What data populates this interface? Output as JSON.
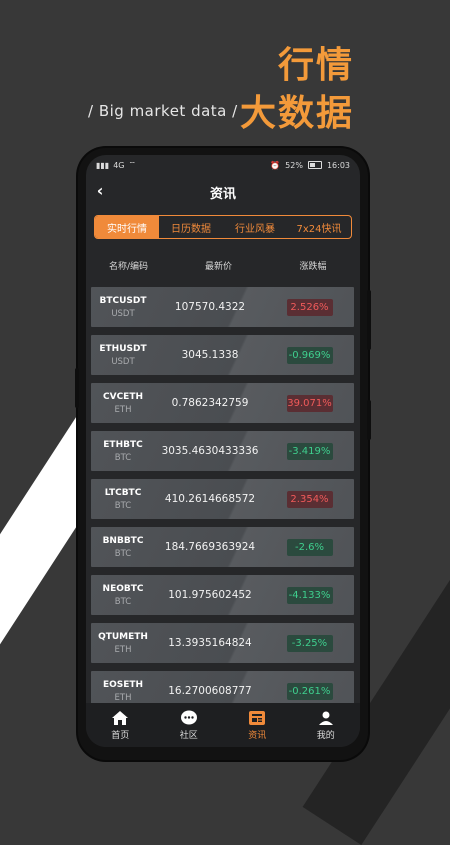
{
  "promo": {
    "title_line1": "行情",
    "title_line2": "大数据",
    "subtitle": "/ Big market data /"
  },
  "statusbar": {
    "left_text": "4G",
    "battery": "52%",
    "time": "16:03"
  },
  "header": {
    "title": "资讯"
  },
  "tabs": [
    {
      "label": "实时行情",
      "active": true
    },
    {
      "label": "日历数据",
      "active": false
    },
    {
      "label": "行业风暴",
      "active": false
    },
    {
      "label": "7x24快讯",
      "active": false
    }
  ],
  "table": {
    "headers": [
      "名称/编码",
      "最新价",
      "涨跌幅"
    ],
    "rows": [
      {
        "symbol": "BTCUSDT",
        "quote": "USDT",
        "price": "107570.4322",
        "change": "2.526%",
        "direction": "up"
      },
      {
        "symbol": "ETHUSDT",
        "quote": "USDT",
        "price": "3045.1338",
        "change": "-0.969%",
        "direction": "down"
      },
      {
        "symbol": "CVCETH",
        "quote": "ETH",
        "price": "0.7862342759",
        "change": "39.071%",
        "direction": "up"
      },
      {
        "symbol": "ETHBTC",
        "quote": "BTC",
        "price": "3035.4630433336",
        "change": "-3.419%",
        "direction": "down"
      },
      {
        "symbol": "LTCBTC",
        "quote": "BTC",
        "price": "410.2614668572",
        "change": "2.354%",
        "direction": "up"
      },
      {
        "symbol": "BNBBTC",
        "quote": "BTC",
        "price": "184.7669363924",
        "change": "-2.6%",
        "direction": "down"
      },
      {
        "symbol": "NEOBTC",
        "quote": "BTC",
        "price": "101.975602452",
        "change": "-4.133%",
        "direction": "down"
      },
      {
        "symbol": "QTUMETH",
        "quote": "ETH",
        "price": "13.3935164824",
        "change": "-3.25%",
        "direction": "down"
      },
      {
        "symbol": "EOSETH",
        "quote": "ETH",
        "price": "16.2700608777",
        "change": "-0.261%",
        "direction": "down"
      }
    ]
  },
  "bottom_nav": [
    {
      "label": "首页",
      "icon": "home-icon",
      "active": false
    },
    {
      "label": "社区",
      "icon": "chat-icon",
      "active": false
    },
    {
      "label": "资讯",
      "icon": "news-icon",
      "active": true
    },
    {
      "label": "我的",
      "icon": "profile-icon",
      "active": false
    }
  ],
  "colors": {
    "accent": "#f08a3a",
    "promo_title": "#f39a3a",
    "up": "#f05a5a",
    "down": "#3fcf8e",
    "background": "#383838"
  }
}
